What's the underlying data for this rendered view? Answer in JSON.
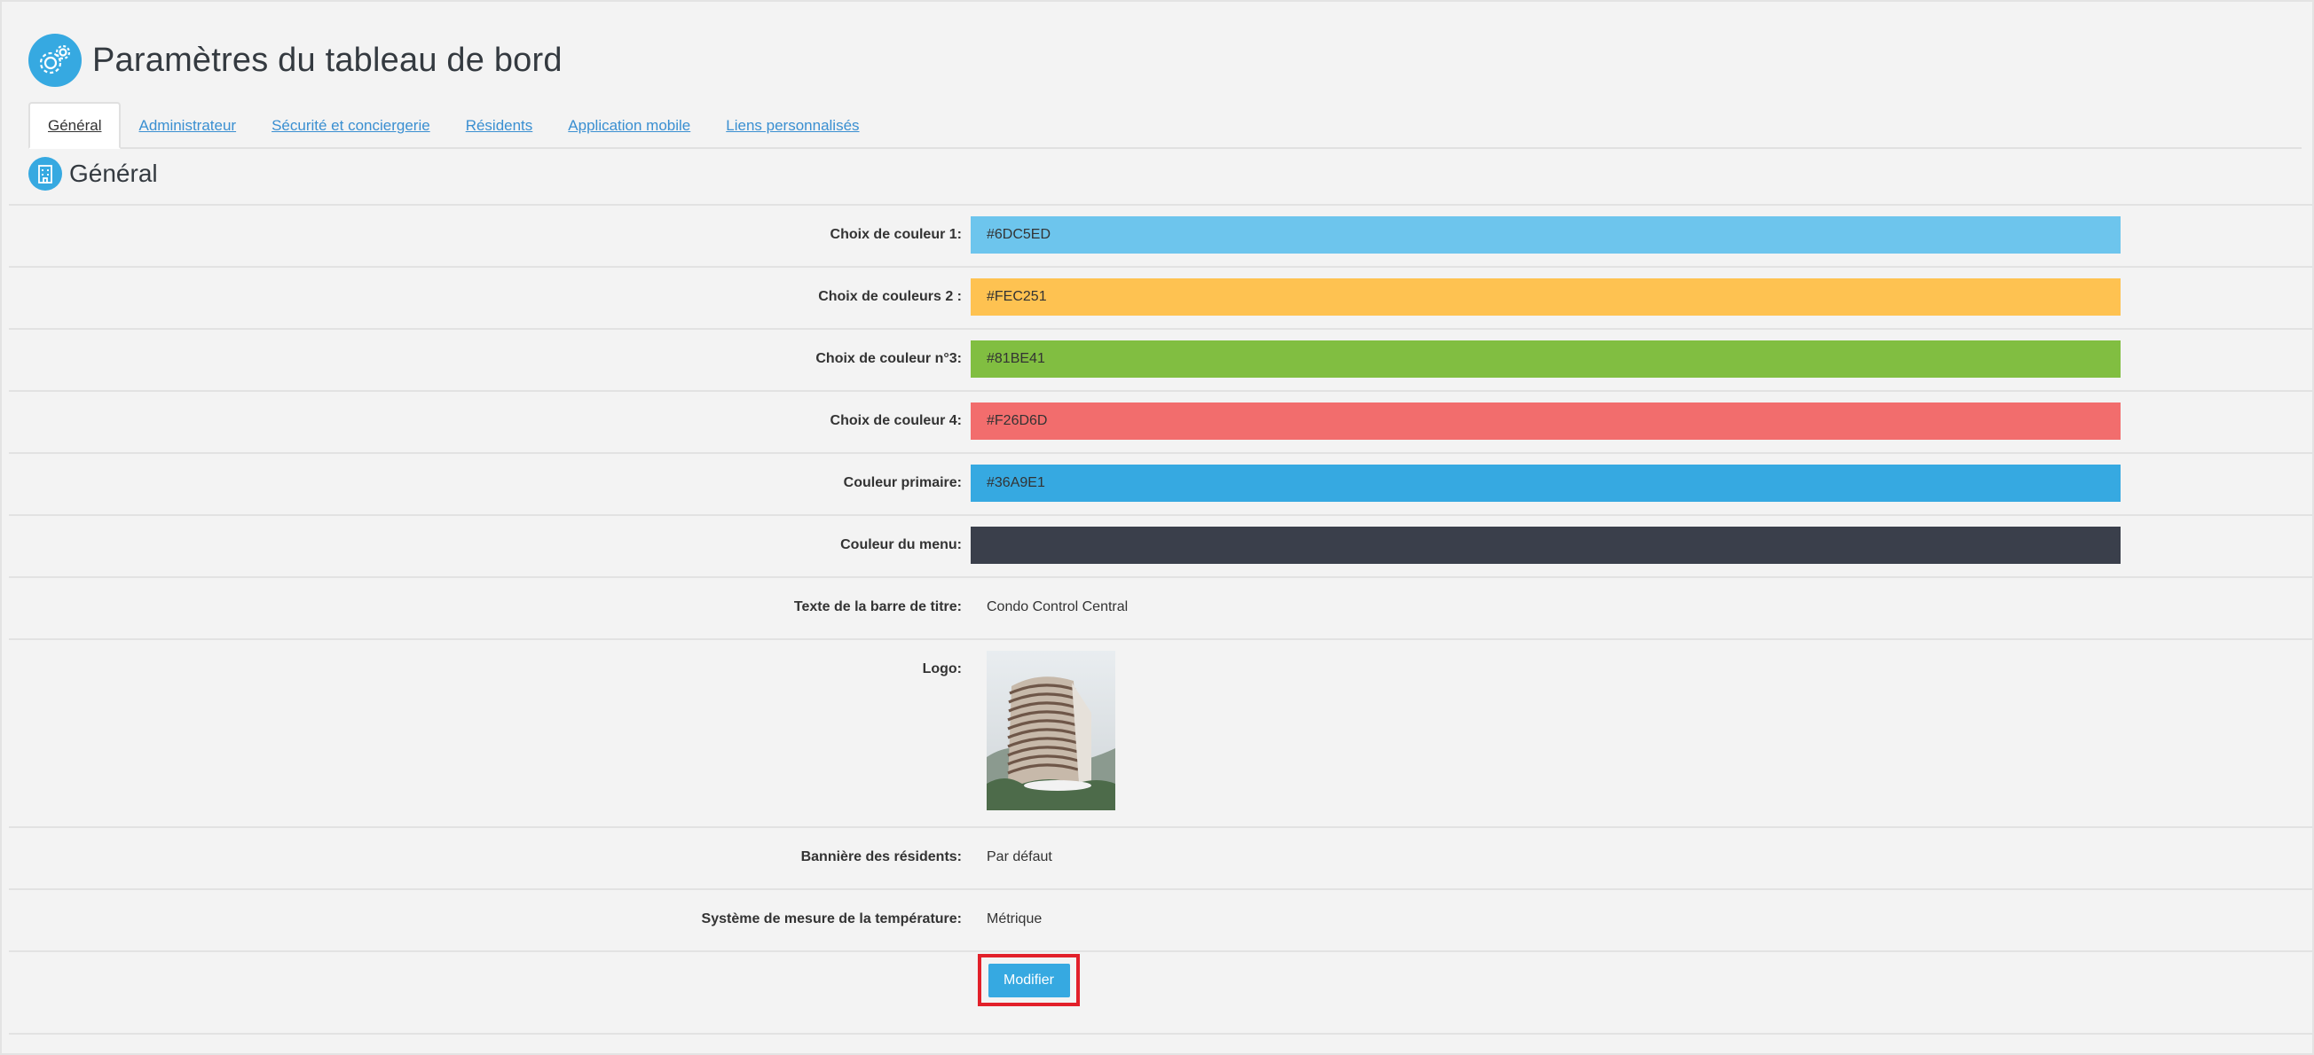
{
  "page_title": "Paramètres du tableau de bord",
  "tabs": [
    {
      "label": "Général",
      "active": true
    },
    {
      "label": "Administrateur",
      "active": false
    },
    {
      "label": "Sécurité et conciergerie",
      "active": false
    },
    {
      "label": "Résidents",
      "active": false
    },
    {
      "label": "Application mobile",
      "active": false
    },
    {
      "label": "Liens personnalisés",
      "active": false
    }
  ],
  "section_title": "Général",
  "colors": {
    "accent": "#36a9e1",
    "highlight_border": "#e2202a"
  },
  "fields": {
    "color1": {
      "label": "Choix de couleur 1:",
      "value": "#6DC5ED"
    },
    "color2": {
      "label": "Choix de couleurs 2 :",
      "value": "#FEC251"
    },
    "color3": {
      "label": "Choix de couleur n°3:",
      "value": "#81BE41"
    },
    "color4": {
      "label": "Choix de couleur 4:",
      "value": "#F26D6D"
    },
    "primary": {
      "label": "Couleur primaire:",
      "value": "#36A9E1"
    },
    "menu": {
      "label": "Couleur du menu:",
      "value": "",
      "swatch": "#3A3F4B"
    },
    "title_bar": {
      "label": "Texte de la barre de titre:",
      "value": "Condo Control Central"
    },
    "logo": {
      "label": "Logo:"
    },
    "banner": {
      "label": "Bannière des résidents:",
      "value": "Par défaut"
    },
    "temperature": {
      "label": "Système de mesure de la température:",
      "value": "Métrique"
    }
  },
  "modify_button": "Modifier",
  "icons": {
    "header": "gears-icon",
    "section": "building-icon"
  }
}
